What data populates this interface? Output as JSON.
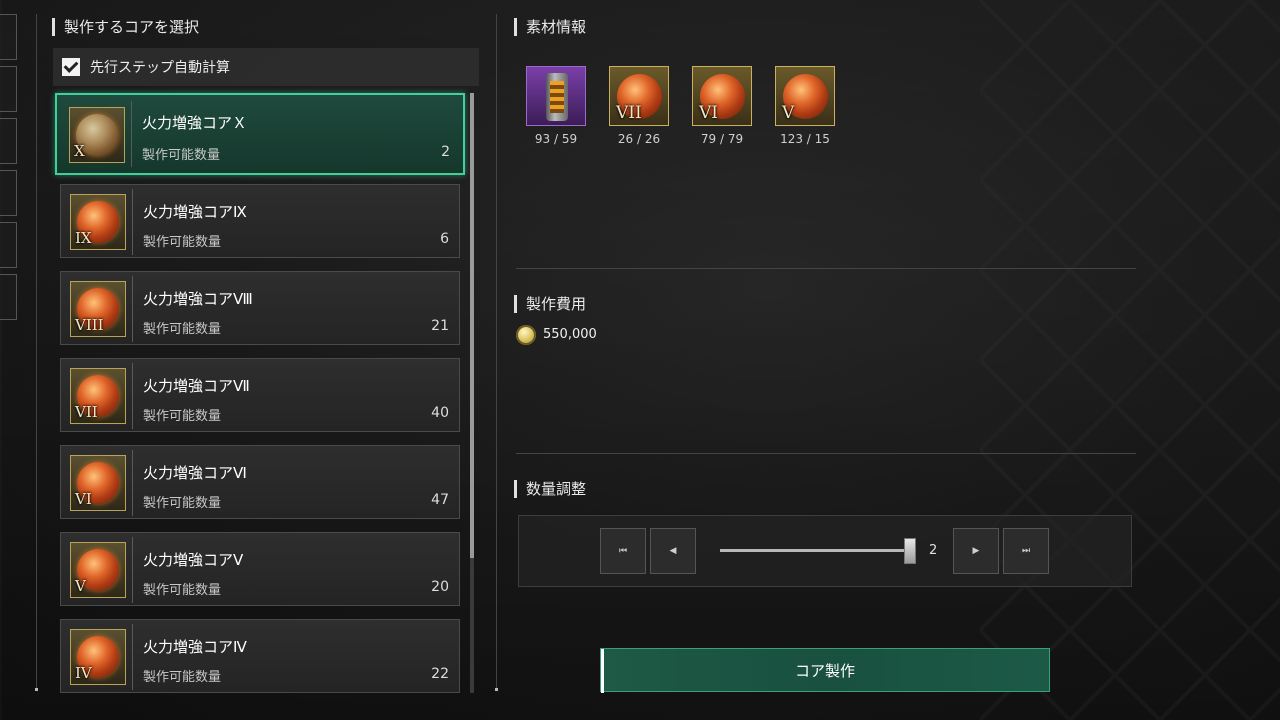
{
  "left_panel": {
    "title": "製作するコアを選択",
    "auto_calc": {
      "label": "先行ステップ自動計算",
      "checked": true
    },
    "sub_label": "製作可能数量",
    "cores": [
      {
        "name": "火力増強コアＸ",
        "roman": "X",
        "count": "2",
        "selected": true
      },
      {
        "name": "火力増強コアⅨ",
        "roman": "IX",
        "count": "6"
      },
      {
        "name": "火力増強コアⅧ",
        "roman": "VIII",
        "count": "21"
      },
      {
        "name": "火力増強コアⅦ",
        "roman": "VII",
        "count": "40"
      },
      {
        "name": "火力増強コアⅥ",
        "roman": "VI",
        "count": "47"
      },
      {
        "name": "火力増強コアⅤ",
        "roman": "V",
        "count": "20"
      },
      {
        "name": "火力増強コアⅣ",
        "roman": "IV",
        "count": "22"
      }
    ]
  },
  "materials": {
    "title": "素材情報",
    "items": [
      {
        "icon": "energy-cylinder-icon",
        "roman": "",
        "count": "93 / 59"
      },
      {
        "icon": "core-orb-icon",
        "roman": "VII",
        "count": "26 / 26"
      },
      {
        "icon": "core-orb-icon",
        "roman": "VI",
        "count": "79 / 79"
      },
      {
        "icon": "core-orb-icon",
        "roman": "V",
        "count": "123 / 15"
      }
    ]
  },
  "cost": {
    "title": "製作費用",
    "value": "550,000",
    "icon": "gold-coin-icon"
  },
  "quantity": {
    "title": "数量調整",
    "value": "2",
    "slider_fraction": 1.0
  },
  "craft_button": {
    "label": "コア製作"
  },
  "colors": {
    "accent_green": "#3ed19a",
    "button_green": "#1e5a45",
    "gold_border": "#c9b160"
  }
}
